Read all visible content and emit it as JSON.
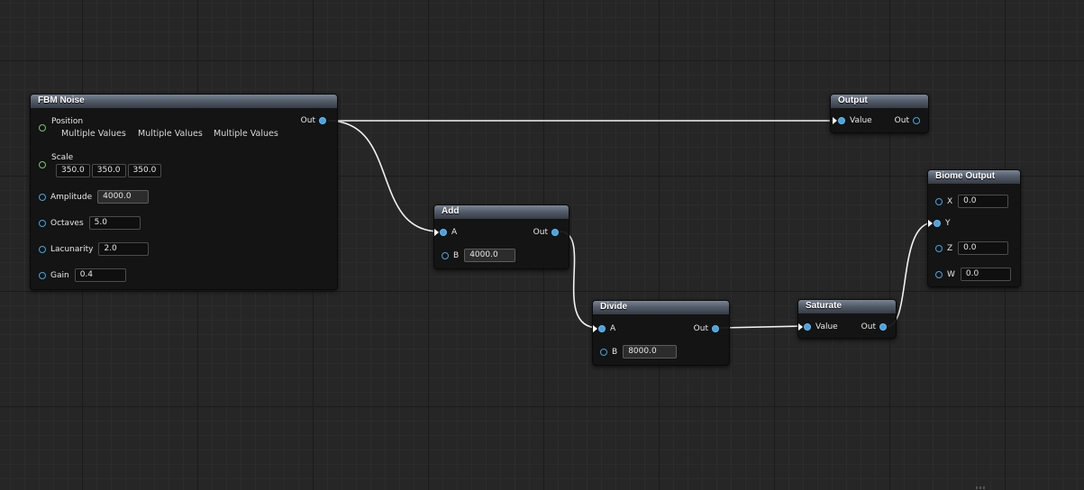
{
  "nodes": {
    "fbm": {
      "title": "FBM Noise",
      "out_label": "Out",
      "position": {
        "label": "Position",
        "values": [
          "Multiple Values",
          "Multiple Values",
          "Multiple Values"
        ]
      },
      "scale": {
        "label": "Scale",
        "values": [
          "350.0",
          "350.0",
          "350.0"
        ]
      },
      "amplitude": {
        "label": "Amplitude",
        "value": "4000.0"
      },
      "octaves": {
        "label": "Octaves",
        "value": "5.0"
      },
      "lacunarity": {
        "label": "Lacunarity",
        "value": "2.0"
      },
      "gain": {
        "label": "Gain",
        "value": "0.4"
      }
    },
    "output": {
      "title": "Output",
      "in_label": "Value",
      "out_label": "Out"
    },
    "add": {
      "title": "Add",
      "a_label": "A",
      "b_label": "B",
      "b_value": "4000.0",
      "out_label": "Out"
    },
    "divide": {
      "title": "Divide",
      "a_label": "A",
      "b_label": "B",
      "b_value": "8000.0",
      "out_label": "Out"
    },
    "saturate": {
      "title": "Saturate",
      "in_label": "Value",
      "out_label": "Out"
    },
    "biome_output": {
      "title": "Biome Output",
      "x_label": "X",
      "x_value": "0.0",
      "y_label": "Y",
      "z_label": "Z",
      "z_value": "0.0",
      "w_label": "W",
      "w_value": "0.0"
    }
  },
  "colors": {
    "background": "#262626",
    "pin_float": "#4aa3e0",
    "pin_vector": "#7ac07a",
    "wire": "#f2f2f2",
    "header_gradient_top": "#7b8594"
  }
}
